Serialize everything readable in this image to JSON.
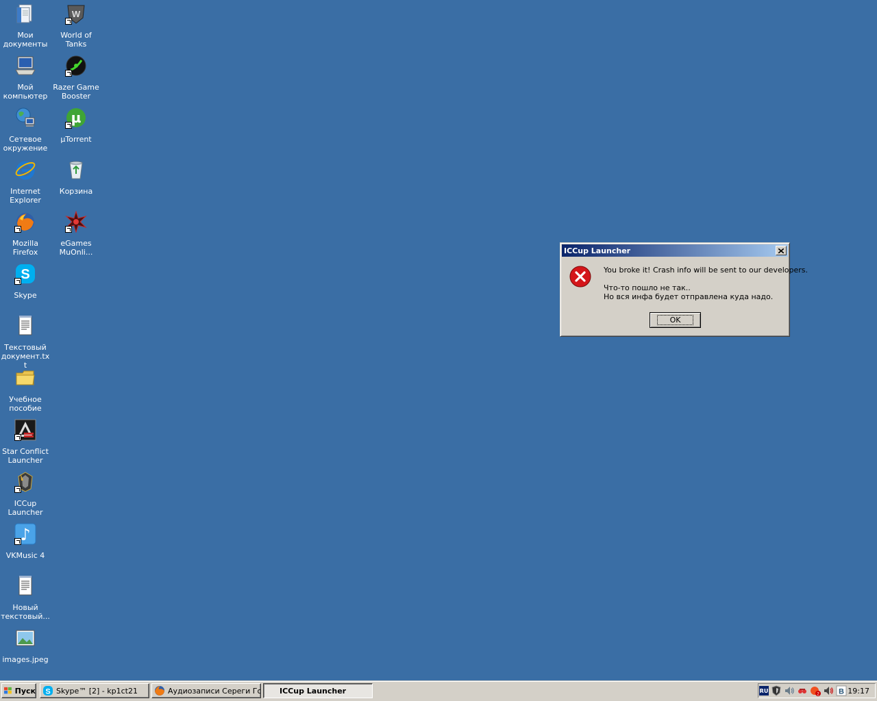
{
  "desktop": {
    "background_color": "#3a6ea5",
    "icons": [
      {
        "label": "Мои\nдокументы",
        "icon": "my-documents-icon",
        "shortcut": false
      },
      {
        "label": "World of\nTanks",
        "icon": "world-of-tanks-icon",
        "shortcut": true
      },
      {
        "label": "Мой\nкомпьютер",
        "icon": "my-computer-icon",
        "shortcut": false
      },
      {
        "label": "Razer Game\nBooster",
        "icon": "razer-game-booster-icon",
        "shortcut": true
      },
      {
        "label": "Сетевое\nокружение",
        "icon": "network-places-icon",
        "shortcut": false
      },
      {
        "label": "µTorrent",
        "icon": "utorrent-icon",
        "shortcut": true
      },
      {
        "label": "Internet\nExplorer",
        "icon": "internet-explorer-icon",
        "shortcut": false
      },
      {
        "label": "Корзина",
        "icon": "recycle-bin-icon",
        "shortcut": false
      },
      {
        "label": "Mozilla Firefox",
        "icon": "firefox-icon",
        "shortcut": true
      },
      {
        "label": "eGames\nMuOnli...",
        "icon": "egames-muonline-icon",
        "shortcut": true
      },
      {
        "label": "Skype",
        "icon": "skype-icon",
        "shortcut": true
      },
      {
        "label": "Текстовый\nдокумент.txt",
        "icon": "text-document-icon",
        "shortcut": false
      },
      {
        "label": "Учебное\nпособие",
        "icon": "folder-icon",
        "shortcut": false
      },
      {
        "label": "Star Conflict\nLauncher",
        "icon": "star-conflict-icon",
        "shortcut": true
      },
      {
        "label": "ICCup\nLauncher",
        "icon": "iccup-launcher-icon",
        "shortcut": true
      },
      {
        "label": "VKMusic 4",
        "icon": "vkmusic-icon",
        "shortcut": true
      },
      {
        "label": "Новый\nтекстовый...",
        "icon": "new-text-document-icon",
        "shortcut": false
      },
      {
        "label": "images.jpeg",
        "icon": "image-file-icon",
        "shortcut": false
      }
    ]
  },
  "dialog": {
    "title": "ICCup Launcher",
    "line1": "You broke it! Crash info will be sent to our developers.",
    "line2": "Что-то пошло не так..",
    "line3": "Но вся инфа будет отправлена куда надо.",
    "ok_label": "OK",
    "icon": "error-icon"
  },
  "taskbar": {
    "start_label": "Пуск",
    "tasks": [
      {
        "label": "Skype™ [2] - kp1ct21",
        "icon": "skype-icon",
        "active": false
      },
      {
        "label": "Аудиозаписи Сереги Го...",
        "icon": "firefox-icon",
        "active": false
      },
      {
        "label": "ICCup Launcher",
        "icon": "iccup-launcher-icon",
        "active": true
      }
    ],
    "tray": {
      "language": "RU",
      "clock": "19:17"
    }
  }
}
